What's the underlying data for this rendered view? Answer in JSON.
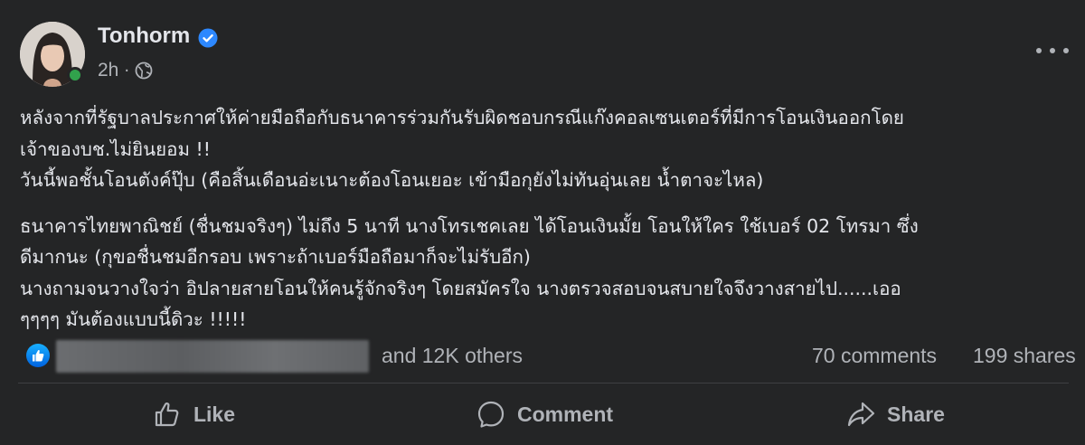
{
  "post": {
    "author": {
      "name": "Tonhorm",
      "verified": true
    },
    "time": "2h",
    "separator": "·",
    "privacy_icon": "globe-icon",
    "paragraphs": [
      [
        "หลังจากที่รัฐบาลประกาศให้ค่ายมือถือกับธนาคารร่วมกันรับผิดชอบกรณีแก๊งคอลเซนเตอร์ที่มีการโอนเงินออกโดย",
        "เจ้าของบช.ไม่ยินยอม !!",
        "วันนี้พอชั้นโอนตังค์ปุ๊บ (คือสิ้นเดือนอ่ะเนาะต้องโอนเยอะ เข้ามือกุยังไม่ทันอุ่นเลย น้ำตาจะไหล)"
      ],
      [
        "ธนาคารไทยพาณิชย์ (ชื่นชมจริงๆ) ไม่ถึง 5 นาที นางโทรเชคเลย ได้โอนเงินมั้ย โอนให้ใคร ใช้เบอร์ 02 โทรมา ซึ่ง",
        "ดีมากนะ (กุขอชื่นชมอีกรอบ เพราะถ้าเบอร์มือถือมาก็จะไม่รับอีก)",
        "นางถามจนวางใจว่า อิปลายสายโอนให้คนรู้จักจริงๆ โดยสมัครใจ นางตรวจสอบจนสบายใจจึงวางสายไป......เออ",
        "ๆๆๆๆ มันต้องแบบนี้ดิวะ !!!!!"
      ]
    ]
  },
  "reactions": {
    "icon": "like-reaction-icon",
    "others_text": "and 12K others",
    "comments_text": "70 comments",
    "shares_text": "199 shares"
  },
  "actions": {
    "like_label": "Like",
    "comment_label": "Comment",
    "share_label": "Share"
  },
  "colors": {
    "background": "#242526",
    "text_primary": "#e4e6eb",
    "text_secondary": "#b0b3b8",
    "accent_blue": "#2d88ff",
    "online_green": "#31a24c"
  }
}
